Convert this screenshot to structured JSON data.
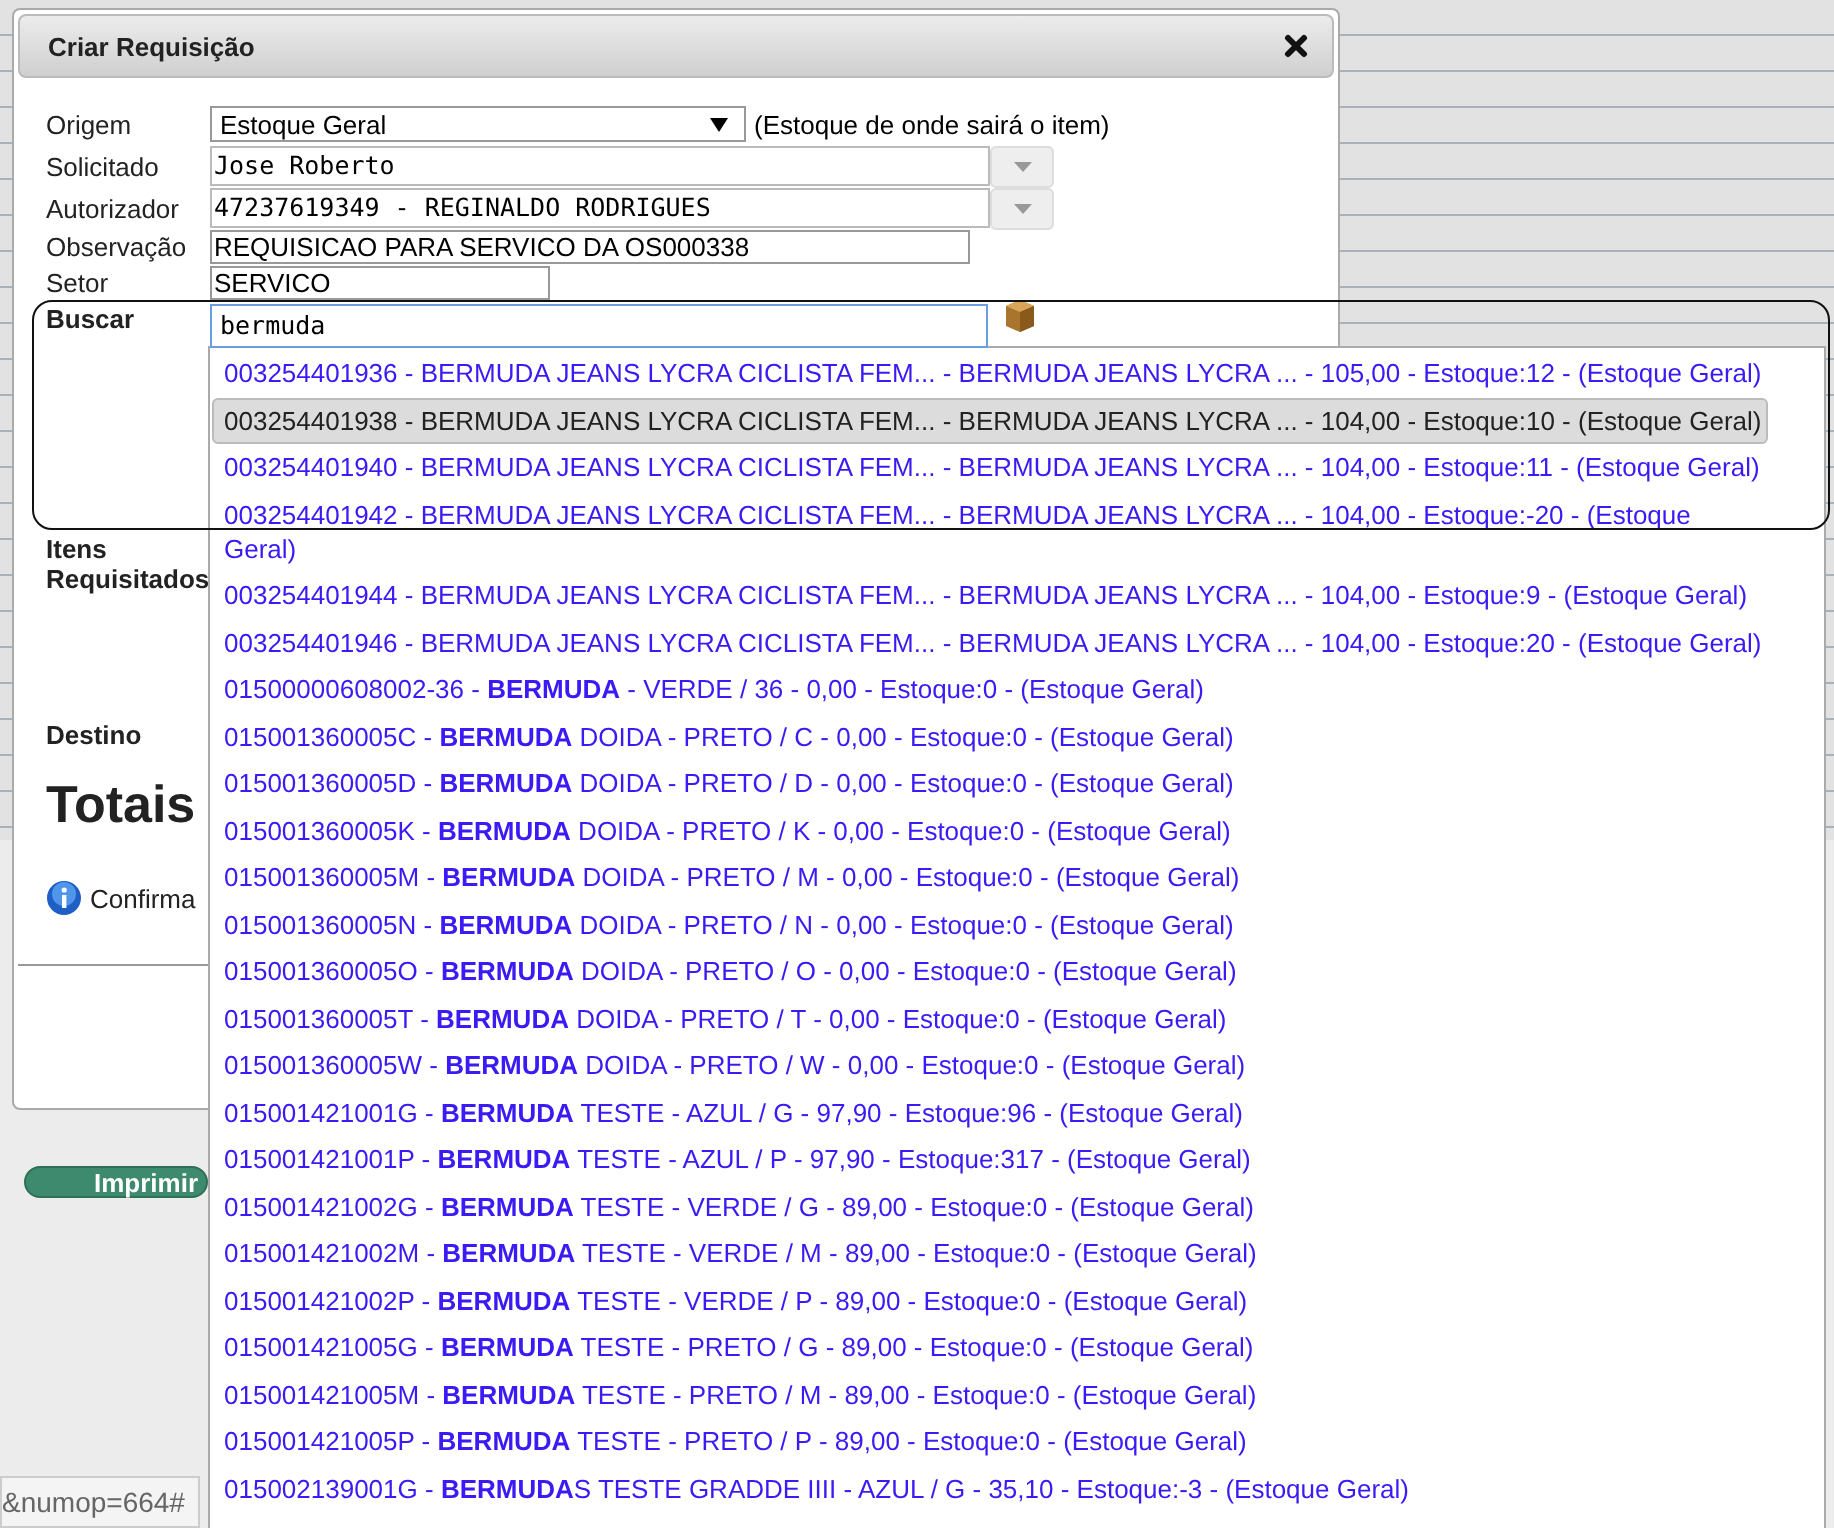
{
  "background": {
    "print_button": "Imprimir",
    "url": "&numop=664#"
  },
  "dialog": {
    "title": "Criar Requisição",
    "fields": [
      {
        "label": "Origem",
        "kind": "select",
        "value": "Estoque Geral",
        "hint": "(Estoque de onde sairá o item)"
      },
      {
        "label": "Solicitado",
        "kind": "combo",
        "value": "Jose Roberto"
      },
      {
        "label": "Autorizador",
        "kind": "combo",
        "value": "47237619349 - REGINALDO RODRIGUES"
      },
      {
        "label": "Observação",
        "kind": "text",
        "value": "REQUISICAO PARA SERVICO DA OS000338"
      },
      {
        "label": "Setor",
        "kind": "short",
        "value": "SERVICO"
      }
    ],
    "search": {
      "label": "Buscar",
      "value": "bermuda"
    },
    "items_label": "Itens Requisitados",
    "destination_label": "Destino",
    "totals": "Totais",
    "confirm": "Confirma"
  },
  "suggestions": [
    {
      "text": "003254401936 - BERMUDA JEANS LYCRA CICLISTA FEM... - BERMUDA JEANS LYCRA ... - 105,00 - Estoque:12 - (Estoque Geral)",
      "selected": false
    },
    {
      "text": "003254401938 - BERMUDA JEANS LYCRA CICLISTA FEM... - BERMUDA JEANS LYCRA ... - 104,00 - Estoque:10 - (Estoque Geral)",
      "selected": true
    },
    {
      "text": "003254401940 - BERMUDA JEANS LYCRA CICLISTA FEM... - BERMUDA JEANS LYCRA ... - 104,00 - Estoque:11 - (Estoque Geral)",
      "selected": false
    },
    {
      "text": "003254401942 - BERMUDA JEANS LYCRA CICLISTA FEM... - BERMUDA JEANS LYCRA ... - 104,00 - Estoque:-20 - (Estoque Geral)",
      "selected": false
    },
    {
      "text": "003254401944 - BERMUDA JEANS LYCRA CICLISTA FEM... - BERMUDA JEANS LYCRA ... - 104,00 - Estoque:9 - (Estoque Geral)",
      "selected": false
    },
    {
      "text": "003254401946 - BERMUDA JEANS LYCRA CICLISTA FEM... - BERMUDA JEANS LYCRA ... - 104,00 - Estoque:20 - (Estoque Geral)",
      "selected": false
    },
    {
      "text": "01500000608002-36 - **BERMUDA** - VERDE / 36 - 0,00 - Estoque:0 - (Estoque Geral)",
      "selected": false
    },
    {
      "text": "015001360005C - **BERMUDA** DOIDA - PRETO / C - 0,00 - Estoque:0 - (Estoque Geral)",
      "selected": false
    },
    {
      "text": "015001360005D - **BERMUDA** DOIDA - PRETO / D - 0,00 - Estoque:0 - (Estoque Geral)",
      "selected": false
    },
    {
      "text": "015001360005K - **BERMUDA** DOIDA - PRETO / K - 0,00 - Estoque:0 - (Estoque Geral)",
      "selected": false
    },
    {
      "text": "015001360005M - **BERMUDA** DOIDA - PRETO / M - 0,00 - Estoque:0 - (Estoque Geral)",
      "selected": false
    },
    {
      "text": "015001360005N - **BERMUDA** DOIDA - PRETO / N - 0,00 - Estoque:0 - (Estoque Geral)",
      "selected": false
    },
    {
      "text": "015001360005O - **BERMUDA** DOIDA - PRETO / O - 0,00 - Estoque:0 - (Estoque Geral)",
      "selected": false
    },
    {
      "text": "015001360005T - **BERMUDA** DOIDA - PRETO / T - 0,00 - Estoque:0 - (Estoque Geral)",
      "selected": false
    },
    {
      "text": "015001360005W - **BERMUDA** DOIDA - PRETO / W - 0,00 - Estoque:0 - (Estoque Geral)",
      "selected": false
    },
    {
      "text": "015001421001G - **BERMUDA** TESTE - AZUL / G - 97,90 - Estoque:96 - (Estoque Geral)",
      "selected": false
    },
    {
      "text": "015001421001P - **BERMUDA** TESTE - AZUL / P - 97,90 - Estoque:317 - (Estoque Geral)",
      "selected": false
    },
    {
      "text": "015001421002G - **BERMUDA** TESTE - VERDE / G - 89,00 - Estoque:0 - (Estoque Geral)",
      "selected": false
    },
    {
      "text": "015001421002M - **BERMUDA** TESTE - VERDE / M - 89,00 - Estoque:0 - (Estoque Geral)",
      "selected": false
    },
    {
      "text": "015001421002P - **BERMUDA** TESTE - VERDE / P - 89,00 - Estoque:0 - (Estoque Geral)",
      "selected": false
    },
    {
      "text": "015001421005G - **BERMUDA** TESTE - PRETO / G - 89,00 - Estoque:0 - (Estoque Geral)",
      "selected": false
    },
    {
      "text": "015001421005M - **BERMUDA** TESTE - PRETO / M - 89,00 - Estoque:0 - (Estoque Geral)",
      "selected": false
    },
    {
      "text": "015001421005P - **BERMUDA** TESTE - PRETO / P - 89,00 - Estoque:0 - (Estoque Geral)",
      "selected": false
    },
    {
      "text": "015002139001G - **BERMUDA**S TESTE GRADDE IIII - AZUL / G - 35,10 - Estoque:-3 - (Estoque Geral)",
      "selected": false
    }
  ]
}
